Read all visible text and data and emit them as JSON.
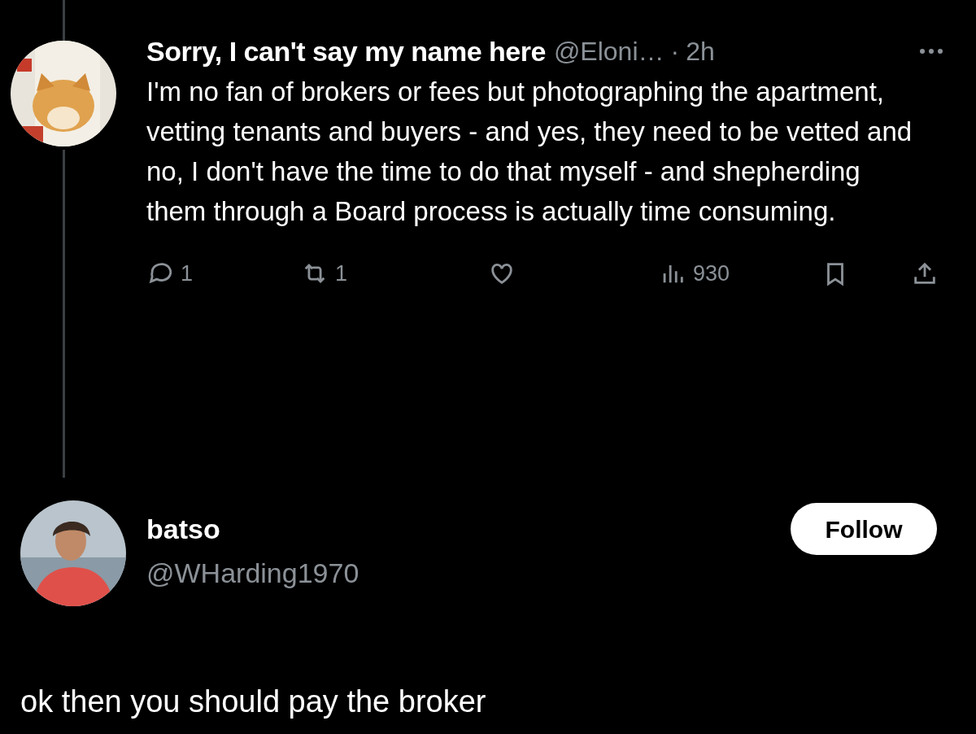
{
  "post": {
    "author": {
      "name": "Sorry, I can't say my name here",
      "handle": "@Eloni…",
      "separator": "·",
      "time": "2h"
    },
    "text": "I'm no fan of brokers or fees but photographing the apartment, vetting tenants and buyers - and yes, they need to be vetted and no, I don't have the time to do that myself - and shepherding them through a Board process is actually time consuming.",
    "actions": [
      {
        "kind": "reply",
        "count": "1"
      },
      {
        "kind": "repost",
        "count": "1"
      },
      {
        "kind": "like"
      },
      {
        "kind": "views",
        "count": "930"
      },
      {
        "kind": "bookmark"
      },
      {
        "kind": "share"
      }
    ]
  },
  "reply": {
    "author": {
      "name": "batso",
      "handle": "@WHarding1970"
    },
    "follow_button": "Follow",
    "text": "ok then you should pay the broker"
  }
}
